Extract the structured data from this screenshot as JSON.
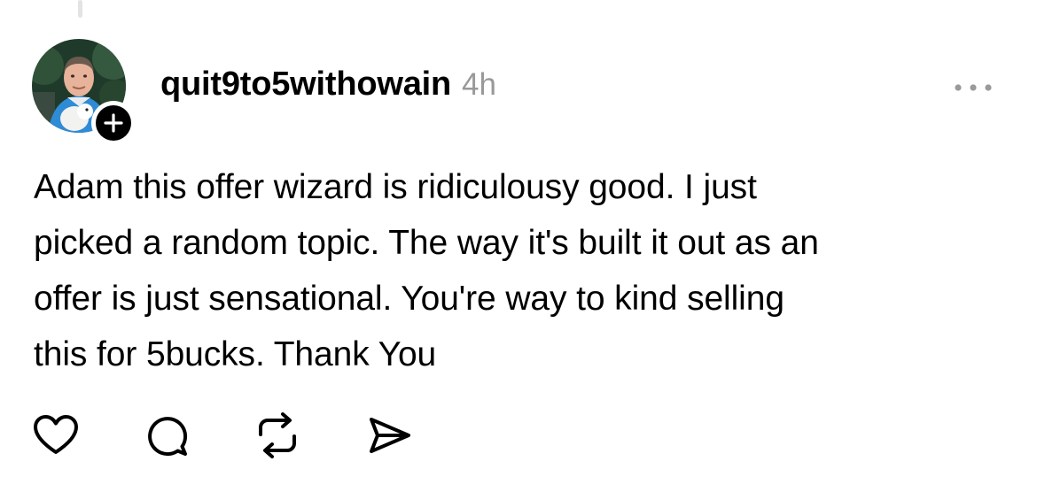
{
  "post": {
    "username": "quit9to5withowain",
    "timestamp": "4h",
    "text": "Adam this offer wizard is ridiculousy good. I just\npicked a random topic. The way it's built it out as an\noffer is just sensational. You're way to kind selling\nthis for 5bucks. Thank You"
  },
  "icons": {
    "more": "more-horizontal-icon",
    "follow": "plus-icon",
    "like": "heart-icon",
    "reply": "comment-icon",
    "repost": "repost-icon",
    "share": "send-icon"
  },
  "colors": {
    "text": "#000000",
    "secondary_text": "#999999",
    "badge": "#000000"
  }
}
